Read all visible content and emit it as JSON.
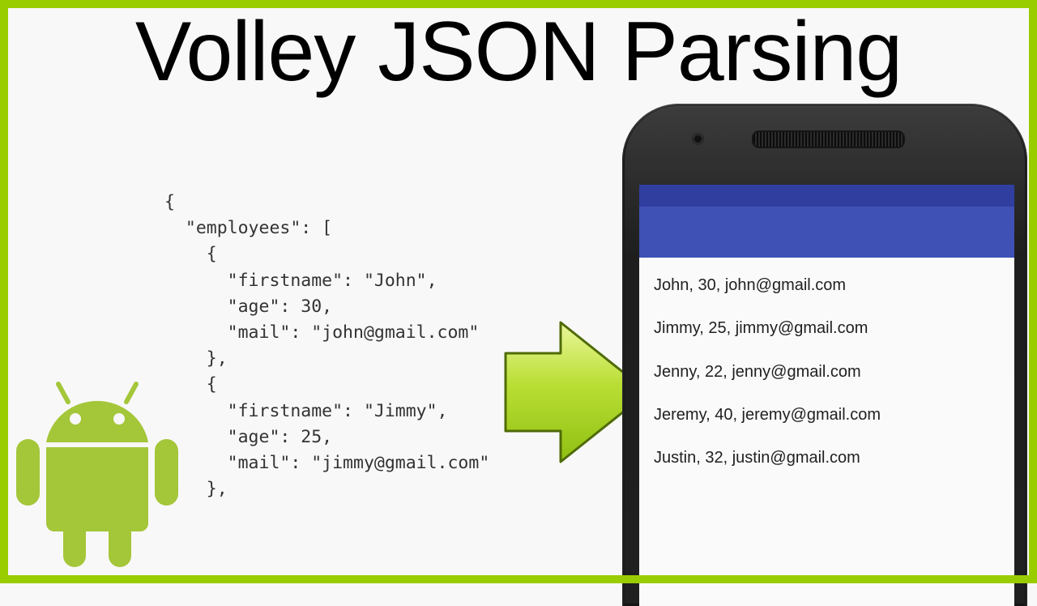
{
  "title": "Volley JSON Parsing",
  "code_lines": [
    "{",
    "  \"employees\": [",
    "    {",
    "      \"firstname\": \"John\",",
    "      \"age\": 30,",
    "      \"mail\": \"john@gmail.com\"",
    "    },",
    "    {",
    "      \"firstname\": \"Jimmy\",",
    "      \"age\": 25,",
    "      \"mail\": \"jimmy@gmail.com\"",
    "    },"
  ],
  "results": [
    "John, 30, john@gmail.com",
    "Jimmy, 25, jimmy@gmail.com",
    "Jenny, 22, jenny@gmail.com",
    "Jeremy, 40, jeremy@gmail.com",
    "Justin, 32, justin@gmail.com"
  ],
  "icons": {
    "android": "android-robot-icon",
    "arrow": "right-arrow-icon"
  },
  "colors": {
    "accent": "#9acd00",
    "primary": "#3f51b5",
    "primary_dark": "#303f9f"
  }
}
